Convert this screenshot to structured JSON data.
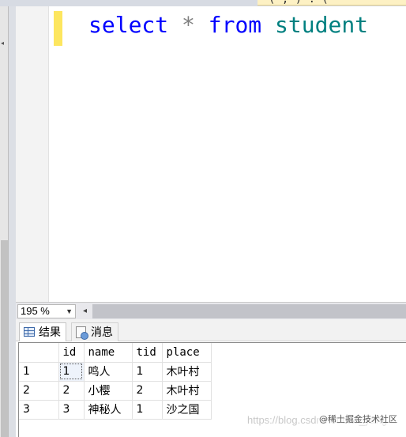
{
  "window": {
    "tab_fragment": "(  ,  )  :  (  "
  },
  "editor": {
    "code": {
      "select_kw": "select",
      "star": "*",
      "from_kw": "from",
      "table": "student"
    }
  },
  "zoom": {
    "value": "195 %"
  },
  "results_tabs": [
    {
      "label": "结果",
      "icon": "grid-icon"
    },
    {
      "label": "消息",
      "icon": "messages-icon"
    }
  ],
  "grid": {
    "columns": [
      "id",
      "name",
      "tid",
      "place"
    ],
    "rows": [
      {
        "row": "1",
        "cells": [
          "1",
          "鸣人",
          "1",
          "木叶村"
        ]
      },
      {
        "row": "2",
        "cells": [
          "2",
          "小樱",
          "2",
          "木叶村"
        ]
      },
      {
        "row": "3",
        "cells": [
          "3",
          "神秘人",
          "1",
          "沙之国"
        ]
      }
    ]
  },
  "watermark": {
    "url": "https://blog.csdn.net/bao_yang",
    "badge": "@稀土掘金技术社区"
  },
  "colors": {
    "keyword": "#0000ff",
    "operator": "#808080",
    "table_name": "#008080",
    "change_bar": "#fde65f"
  }
}
